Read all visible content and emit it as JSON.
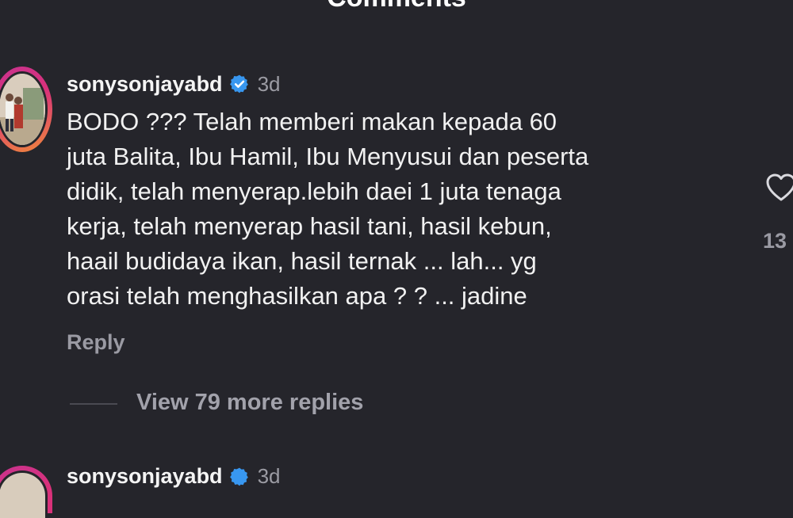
{
  "header": {
    "title": "Comments"
  },
  "comment": {
    "username": "sonysonjayabd",
    "time": "3d",
    "text": "BODO ??? Telah memberi makan kepada 60\njuta Balita, Ibu Hamil, Ibu Menyusui dan peserta\ndidik, telah menyerap.lebih daei 1 juta tenaga\nkerja, telah menyerap hasil tani, hasil kebun,\nhaail budidaya ikan, hasil ternak ... lah... yg\norasi telah menghasilkan apa ? ? ... jadine",
    "reply_label": "Reply",
    "like_count": "13",
    "view_replies_label": "View 79 more replies"
  },
  "comment2": {
    "username": "sonysonjayabd",
    "time": "3d"
  },
  "colors": {
    "background": "#25252b",
    "verified": "#3897f0",
    "secondary_text": "#9b9ba3"
  },
  "icons": [
    "verified-badge-icon",
    "heart-icon"
  ]
}
